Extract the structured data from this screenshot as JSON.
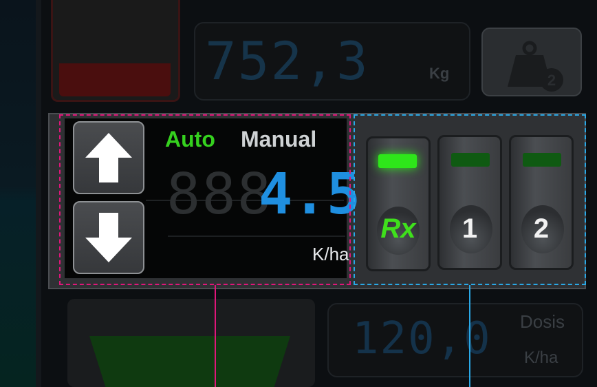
{
  "top": {
    "weight_value": "752,3",
    "weight_unit": "Kg",
    "scale_icon": "weight-bin-2-icon"
  },
  "rate": {
    "mode_auto_label": "Auto",
    "mode_manual_label": "Manual",
    "ghost_digits": "888",
    "value": "4.5",
    "unit": "K/ha",
    "up_icon": "arrow-up-icon",
    "down_icon": "arrow-down-icon"
  },
  "sections": [
    {
      "label": "Rx",
      "led_state": "on"
    },
    {
      "label": "1",
      "led_state": "off"
    },
    {
      "label": "2",
      "led_state": "off"
    }
  ],
  "bottom": {
    "dose_value": "120,0",
    "dose_label": "Dosis",
    "dose_unit": "K/ha"
  },
  "colors": {
    "auto_green": "#35d11e",
    "rate_blue": "#1f8fe0",
    "highlight_magenta": "#e0167a",
    "highlight_cyan": "#2aa8e6"
  }
}
